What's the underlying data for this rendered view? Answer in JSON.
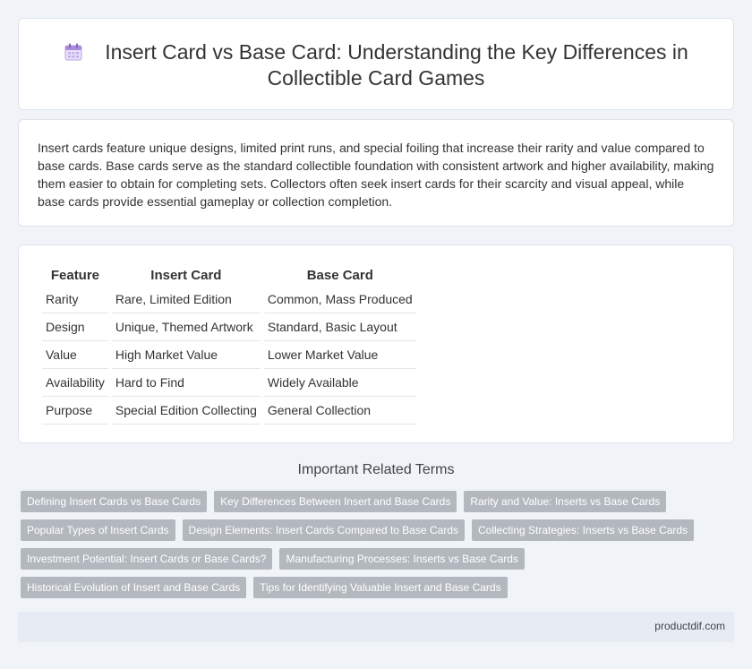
{
  "header": {
    "icon": "calendar-icon",
    "title": "Insert Card vs Base Card: Understanding the Key Differences in Collectible Card Games"
  },
  "intro": {
    "text": "Insert cards feature unique designs, limited print runs, and special foiling that increase their rarity and value compared to base cards. Base cards serve as the standard collectible foundation with consistent artwork and higher availability, making them easier to obtain for completing sets. Collectors often seek insert cards for their scarcity and visual appeal, while base cards provide essential gameplay or collection completion."
  },
  "comparison": {
    "headers": [
      "Feature",
      "Insert Card",
      "Base Card"
    ],
    "rows": [
      [
        "Rarity",
        "Rare, Limited Edition",
        "Common, Mass Produced"
      ],
      [
        "Design",
        "Unique, Themed Artwork",
        "Standard, Basic Layout"
      ],
      [
        "Value",
        "High Market Value",
        "Lower Market Value"
      ],
      [
        "Availability",
        "Hard to Find",
        "Widely Available"
      ],
      [
        "Purpose",
        "Special Edition Collecting",
        "General Collection"
      ]
    ]
  },
  "related": {
    "title": "Important Related Terms",
    "tags": [
      "Defining Insert Cards vs Base Cards",
      "Key Differences Between Insert and Base Cards",
      "Rarity and Value: Inserts vs Base Cards",
      "Popular Types of Insert Cards",
      "Design Elements: Insert Cards Compared to Base Cards",
      "Collecting Strategies: Inserts vs Base Cards",
      "Investment Potential: Insert Cards or Base Cards?",
      "Manufacturing Processes: Inserts vs Base Cards",
      "Historical Evolution of Insert and Base Cards",
      "Tips for Identifying Valuable Insert and Base Cards"
    ]
  },
  "footer": {
    "site": "productdif.com"
  },
  "colors": {
    "page_bg": "#f0f3f8",
    "tag_bg": "#b3b8bf",
    "footer_bg": "#e6ebf4"
  }
}
